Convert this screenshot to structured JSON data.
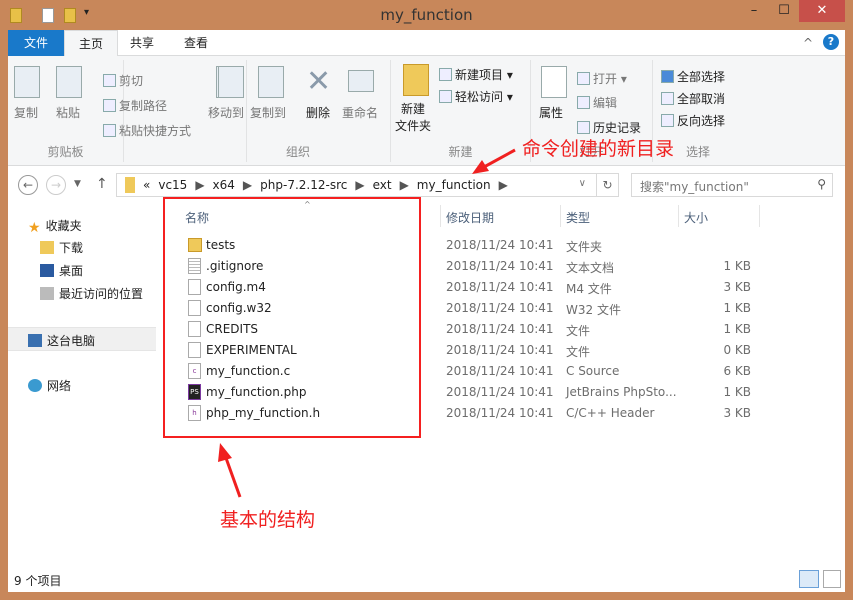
{
  "window": {
    "title": "my_function"
  },
  "tabs": {
    "file": "文件",
    "home": "主页",
    "share": "共享",
    "view": "查看"
  },
  "ribbon": {
    "clipboard": {
      "label": "剪贴板",
      "copy": "复制",
      "paste": "粘贴",
      "cut": "剪切",
      "copy_path": "复制路径",
      "paste_shortcut": "粘贴快捷方式"
    },
    "organize": {
      "label": "组织",
      "move_to": "移动到",
      "copy_to": "复制到",
      "delete": "删除",
      "rename": "重命名"
    },
    "new": {
      "label": "新建",
      "new_folder_1": "新建",
      "new_folder_2": "文件夹",
      "new_item": "新建项目",
      "easy_access": "轻松访问"
    },
    "open": {
      "label": "打开",
      "properties": "属性",
      "open": "打开",
      "edit": "编辑",
      "history": "历史记录"
    },
    "select": {
      "label": "选择",
      "select_all": "全部选择",
      "select_none": "全部取消",
      "invert": "反向选择"
    }
  },
  "address": {
    "overflow": "«",
    "crumbs": [
      "vc15",
      "x64",
      "php-7.2.12-src",
      "ext",
      "my_function"
    ],
    "search_placeholder": "搜索\"my_function\""
  },
  "sidebar": {
    "favorites": "收藏夹",
    "downloads": "下载",
    "desktop": "桌面",
    "recent": "最近访问的位置",
    "this_pc": "这台电脑",
    "network": "网络"
  },
  "columns": {
    "name": "名称",
    "date": "修改日期",
    "type": "类型",
    "size": "大小"
  },
  "files": [
    {
      "name": "tests",
      "date": "2018/11/24 10:41",
      "type": "文件夹",
      "size": "",
      "icon": "folder"
    },
    {
      "name": ".gitignore",
      "date": "2018/11/24 10:41",
      "type": "文本文档",
      "size": "1 KB",
      "icon": "txt"
    },
    {
      "name": "config.m4",
      "date": "2018/11/24 10:41",
      "type": "M4 文件",
      "size": "3 KB",
      "icon": "file"
    },
    {
      "name": "config.w32",
      "date": "2018/11/24 10:41",
      "type": "W32 文件",
      "size": "1 KB",
      "icon": "file"
    },
    {
      "name": "CREDITS",
      "date": "2018/11/24 10:41",
      "type": "文件",
      "size": "1 KB",
      "icon": "file"
    },
    {
      "name": "EXPERIMENTAL",
      "date": "2018/11/24 10:41",
      "type": "文件",
      "size": "0 KB",
      "icon": "file"
    },
    {
      "name": "my_function.c",
      "date": "2018/11/24 10:41",
      "type": "C Source",
      "size": "6 KB",
      "icon": "c"
    },
    {
      "name": "my_function.php",
      "date": "2018/11/24 10:41",
      "type": "JetBrains PhpSto...",
      "size": "1 KB",
      "icon": "ps"
    },
    {
      "name": "php_my_function.h",
      "date": "2018/11/24 10:41",
      "type": "C/C++ Header",
      "size": "3 KB",
      "icon": "h"
    }
  ],
  "status": {
    "count": "9 个项目"
  },
  "annotations": {
    "top": "命令创建的新目录",
    "bottom": "基本的结构",
    "color": "#f02020"
  }
}
